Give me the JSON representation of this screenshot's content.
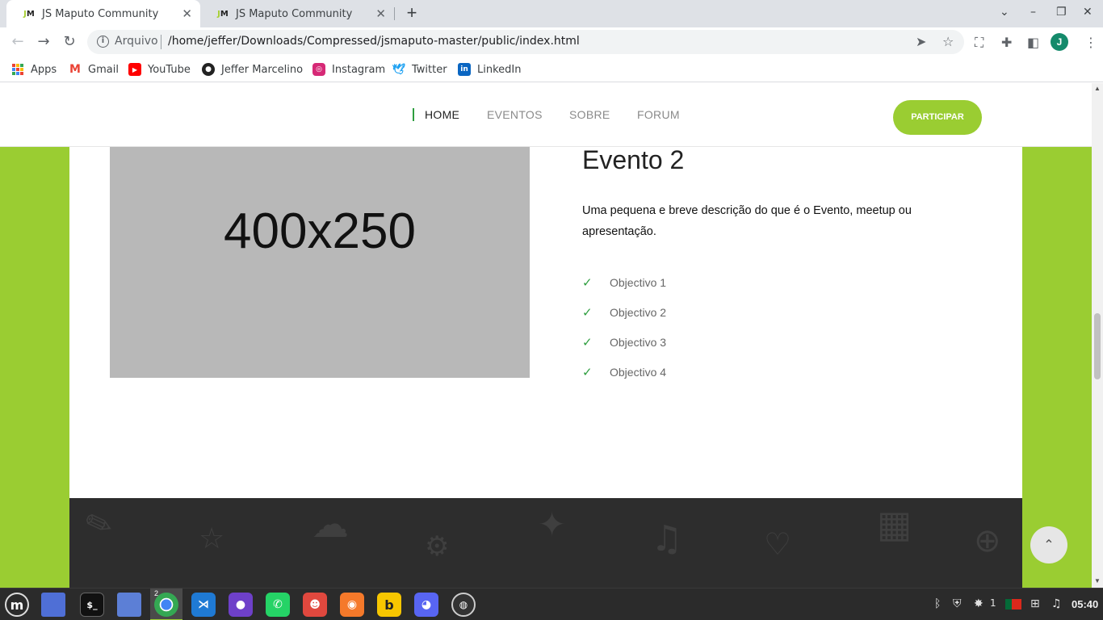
{
  "browser": {
    "tabs": [
      {
        "title": "JS Maputo Community",
        "favicon": "JM"
      },
      {
        "title": "JS Maputo Community",
        "favicon": "JM"
      }
    ],
    "omnibox": {
      "scheme_label": "Arquivo",
      "url": "/home/jeffer/Downloads/Compressed/jsmaputo-master/public/index.html"
    },
    "profile_initial": "J",
    "bookmarks": [
      "Apps",
      "Gmail",
      "YouTube",
      "Jeffer Marcelino",
      "Instagram",
      "Twitter",
      "LinkedIn"
    ]
  },
  "site": {
    "nav": [
      "HOME",
      "EVENTOS",
      "SOBRE",
      "FORUM"
    ],
    "active_nav": "HOME",
    "cta_label": "PARTICIPAR",
    "accent_color": "#9acd32"
  },
  "event": {
    "image_placeholder": "400x250",
    "title": "Evento 2",
    "description": "Uma pequena e breve descrição do que é o Evento, meetup ou apresentação.",
    "objectives": [
      "Objectivo 1",
      "Objectivo 2",
      "Objectivo 3",
      "Objectivo 4"
    ]
  },
  "taskbar": {
    "chrome_window_count": "2",
    "tray_notification_count": "1",
    "clock": "05:40"
  }
}
